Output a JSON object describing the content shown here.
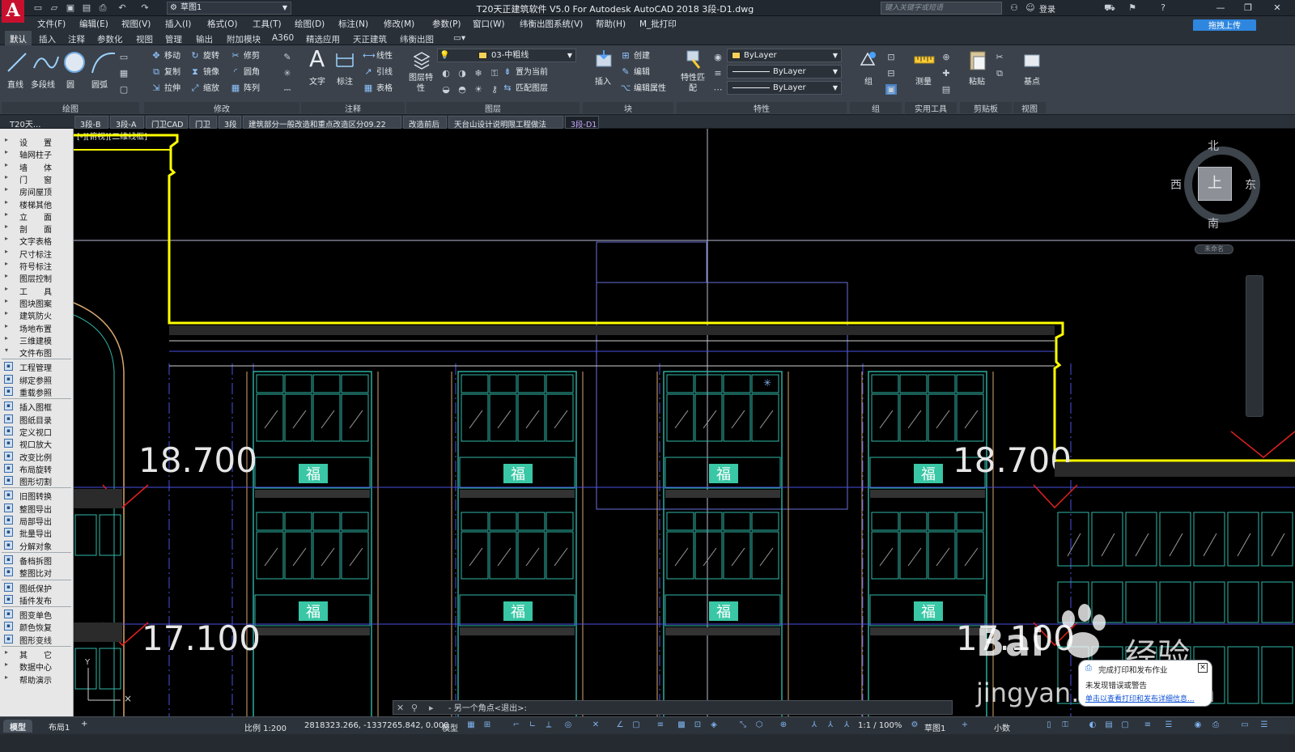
{
  "window": {
    "title": "T20天正建筑软件 V5.0 For Autodesk AutoCAD 2018    3段-D1.dwg",
    "workspace": "草图1",
    "search_placeholder": "键入关键字或短语",
    "login": "登录",
    "app_letter": "A"
  },
  "menu": [
    "文件(F)",
    "编辑(E)",
    "视图(V)",
    "插入(I)",
    "格式(O)",
    "工具(T)",
    "绘图(D)",
    "标注(N)",
    "修改(M)",
    "参数(P)",
    "窗口(W)",
    "纬衡出图系统(V)",
    "帮助(H)",
    "M_批打印"
  ],
  "cloud_button": "拖拽上传",
  "ribbon_tabs": [
    "默认",
    "插入",
    "注释",
    "参数化",
    "视图",
    "管理",
    "输出",
    "附加模块",
    "A360",
    "精选应用",
    "天正建筑",
    "纬衡出图"
  ],
  "ribbon": {
    "draw": {
      "line": "直线",
      "polyline": "多段线",
      "circle": "圆",
      "arc": "圆弧",
      "title": "绘图"
    },
    "modify": {
      "move": "移动",
      "rotate": "旋转",
      "trim": "修剪",
      "copy": "复制",
      "mirror": "镜像",
      "fillet": "圆角",
      "stretch": "拉伸",
      "scale": "缩放",
      "array": "阵列",
      "title": "修改"
    },
    "annotation": {
      "text": "文字",
      "dimension": "标注",
      "linear": "线性",
      "leader": "引线",
      "table": "表格",
      "title": "注释"
    },
    "layers": {
      "properties": "图层特性",
      "current_layer": "03-中粗线",
      "set_current": "置为当前",
      "match": "匹配图层",
      "title": "图层"
    },
    "block": {
      "insert": "插入",
      "create": "创建",
      "edit": "编辑",
      "edit_attr": "编辑属性",
      "title": "块"
    },
    "properties": {
      "match": "特性匹配",
      "color": "ByLayer",
      "linetype": "ByLayer",
      "lineweight": "ByLayer",
      "title": "特性"
    },
    "group": {
      "group": "组",
      "title": "组"
    },
    "utilities": {
      "measure": "测量",
      "title": "实用工具"
    },
    "clipboard": {
      "paste": "粘贴",
      "title": "剪贴板"
    },
    "view": {
      "base": "基点",
      "title": "视图"
    }
  },
  "doc_tabs": {
    "left_label": "T20天...",
    "tabs": [
      "3段-B",
      "3段-A",
      "门卫CAD",
      "门卫",
      "3段",
      "建筑部分一般改造和重点改造区分09.22",
      "改造前后",
      "天台山设计说明限工程做法",
      "3段-D1"
    ],
    "active_index": 8
  },
  "viewport_label": "[-][俯视][二维线框]",
  "palette": {
    "group1": [
      "设　　置",
      "轴网柱子",
      "墙　　体",
      "门　　窗",
      "房间屋顶",
      "楼梯其他",
      "立　　面",
      "剖　　面",
      "文字表格",
      "尺寸标注",
      "符号标注",
      "图层控制",
      "工　　具",
      "图块图案",
      "建筑防火",
      "场地布置",
      "三维建模",
      "文件布图"
    ],
    "group2": [
      "工程管理",
      "绑定参照",
      "重载参照"
    ],
    "group3": [
      "插入图框",
      "图纸目录",
      "定义视口",
      "视口放大",
      "改变比例",
      "布局旋转",
      "图形切割"
    ],
    "group4": [
      "旧图转换",
      "整图导出",
      "局部导出",
      "批量导出",
      "分解对象"
    ],
    "group5": [
      "备档拆图",
      "整图比对"
    ],
    "group6": [
      "图纸保护",
      "插件发布"
    ],
    "group7": [
      "图变单色",
      "颜色恢复",
      "图形变线"
    ],
    "group8": [
      "其　　它",
      "数据中心",
      "帮助演示"
    ]
  },
  "drawing": {
    "elevation_1": "18.700",
    "elevation_2": "17.100",
    "window_char": "福",
    "colors": {
      "outline": "#ffff00",
      "window": "#2fb8a8",
      "panel": "#39c7a5",
      "grid": "#b7bcd6",
      "axis": "#4a4fe0",
      "red": "#e02020"
    }
  },
  "viewcube": {
    "north": "北",
    "south": "南",
    "east": "东",
    "west": "西",
    "top": "上",
    "unnamed": "未命名"
  },
  "command_line": "- 另一个角点<退出>:",
  "notification": {
    "title": "完成打印和发布作业",
    "message": "未发现错误或警告",
    "link": "单击以查看打印和发布详细信息..."
  },
  "watermark": {
    "brand": "Bai",
    "brand_cn": "经验",
    "url": "jingyan.baidu.com"
  },
  "status": {
    "tab_model": "模型",
    "tab_layout": "布局1",
    "scale": "比例 1:200",
    "coords": "2818323.266, -1337265.842, 0.000",
    "mode": "模型",
    "annot_scale": "1:1 / 100%",
    "workspace": "草图1",
    "units": "小数"
  }
}
